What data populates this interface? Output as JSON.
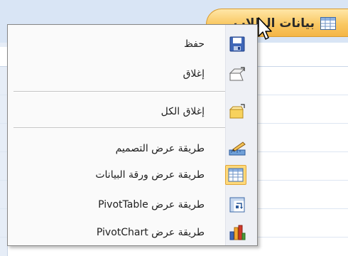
{
  "document_tab": {
    "title": "بيانات الطلاب",
    "icon": "table-icon",
    "color": "#f9c863"
  },
  "context_menu": {
    "items": [
      {
        "label": "حفظ",
        "icon": "save-icon"
      },
      {
        "label": "إغلاق",
        "icon": "close-icon"
      },
      {
        "label": "إغلاق الكل",
        "icon": "close-all-icon"
      },
      {
        "label": "طريقة عرض التصميم",
        "icon": "design-view-icon"
      },
      {
        "label": "طريقة عرض ورقة البيانات",
        "icon": "datasheet-view-icon",
        "selected": true
      },
      {
        "label": "طريقة عرض PivotTable",
        "icon": "pivottable-view-icon"
      },
      {
        "label": "طريقة عرض PivotChart",
        "icon": "pivotchart-view-icon"
      }
    ]
  },
  "colors": {
    "menu_background": "#fafafa",
    "selected_highlight": "#ffd979",
    "tab_background": "#f9c863",
    "top_band": "#d9e5f5"
  }
}
